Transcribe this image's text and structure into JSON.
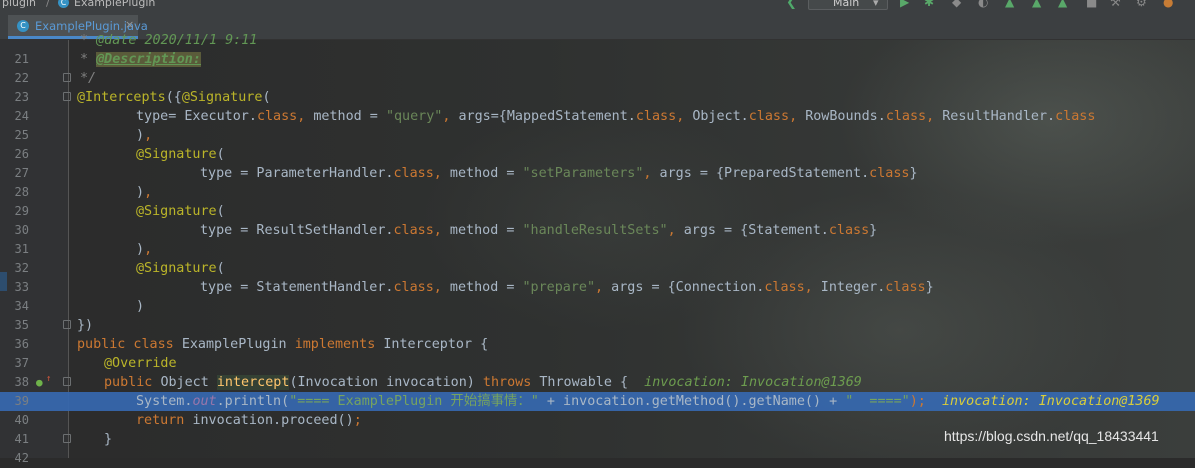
{
  "breadcrumb": {
    "project": "plugin",
    "file": "ExamplePlugin"
  },
  "toolbar": {
    "run_config": "Main",
    "run_config_caret": "▾"
  },
  "tab": {
    "label": "ExamplePlugin.java",
    "icon_letter": "C",
    "close": "×"
  },
  "gutter": {
    "icons": [
      "implements-method-icon",
      "fold-icon"
    ]
  },
  "editor": {
    "lines": [
      {
        "n": "",
        "indent": 1,
        "tokens": [
          {
            "t": "* ",
            "c": "cmt"
          },
          {
            "t": "@date 2020/11/1 9:11",
            "c": "doc"
          }
        ]
      },
      {
        "n": "21",
        "indent": 1,
        "tokens": [
          {
            "t": "* ",
            "c": "cmt"
          },
          {
            "t": "@Description:",
            "c": "doctag"
          }
        ]
      },
      {
        "n": "22",
        "indent": 1,
        "fold": true,
        "tokens": [
          {
            "t": "*/",
            "c": "cmt"
          }
        ]
      },
      {
        "n": "23",
        "indent": 0,
        "fold": true,
        "tokens": [
          {
            "t": "@Intercepts",
            "c": "ann"
          },
          {
            "t": "({",
            "c": "def"
          },
          {
            "t": "@Signature",
            "c": "ann"
          },
          {
            "t": "(",
            "c": "def"
          }
        ]
      },
      {
        "n": "24",
        "indent": 8,
        "tokens": [
          {
            "t": "type",
            "c": "def"
          },
          {
            "t": "= Executor.",
            "c": "def"
          },
          {
            "t": "class",
            "c": "kw"
          },
          {
            "t": ", ",
            "c": "kw"
          },
          {
            "t": "method = ",
            "c": "def"
          },
          {
            "t": "\"query\"",
            "c": "str"
          },
          {
            "t": ", ",
            "c": "kw"
          },
          {
            "t": "args={MappedStatement.",
            "c": "def"
          },
          {
            "t": "class",
            "c": "kw"
          },
          {
            "t": ", ",
            "c": "kw"
          },
          {
            "t": "Object.",
            "c": "def"
          },
          {
            "t": "class",
            "c": "kw"
          },
          {
            "t": ", ",
            "c": "kw"
          },
          {
            "t": "RowBounds.",
            "c": "def"
          },
          {
            "t": "class",
            "c": "kw"
          },
          {
            "t": ", ",
            "c": "kw"
          },
          {
            "t": "ResultHandler.",
            "c": "def"
          },
          {
            "t": "class",
            "c": "kw"
          }
        ]
      },
      {
        "n": "25",
        "indent": 8,
        "tokens": [
          {
            "t": ")",
            "c": "def"
          },
          {
            "t": ",",
            "c": "kw"
          }
        ]
      },
      {
        "n": "26",
        "indent": 8,
        "tokens": [
          {
            "t": "@Signature",
            "c": "ann"
          },
          {
            "t": "(",
            "c": "def"
          }
        ]
      },
      {
        "n": "27",
        "indent": 16,
        "tokens": [
          {
            "t": "type = ParameterHandler.",
            "c": "def"
          },
          {
            "t": "class",
            "c": "kw"
          },
          {
            "t": ", ",
            "c": "kw"
          },
          {
            "t": "method = ",
            "c": "def"
          },
          {
            "t": "\"setParameters\"",
            "c": "str"
          },
          {
            "t": ", ",
            "c": "kw"
          },
          {
            "t": "args = {PreparedStatement.",
            "c": "def"
          },
          {
            "t": "class",
            "c": "kw"
          },
          {
            "t": "}",
            "c": "def"
          }
        ]
      },
      {
        "n": "28",
        "indent": 8,
        "tokens": [
          {
            "t": ")",
            "c": "def"
          },
          {
            "t": ",",
            "c": "kw"
          }
        ]
      },
      {
        "n": "29",
        "indent": 8,
        "tokens": [
          {
            "t": "@Signature",
            "c": "ann"
          },
          {
            "t": "(",
            "c": "def"
          }
        ]
      },
      {
        "n": "30",
        "indent": 16,
        "tokens": [
          {
            "t": "type = ResultSetHandler.",
            "c": "def"
          },
          {
            "t": "class",
            "c": "kw"
          },
          {
            "t": ", ",
            "c": "kw"
          },
          {
            "t": "method = ",
            "c": "def"
          },
          {
            "t": "\"handleResultSets\"",
            "c": "str"
          },
          {
            "t": ", ",
            "c": "kw"
          },
          {
            "t": "args = {Statement.",
            "c": "def"
          },
          {
            "t": "class",
            "c": "kw"
          },
          {
            "t": "}",
            "c": "def"
          }
        ]
      },
      {
        "n": "31",
        "indent": 8,
        "tokens": [
          {
            "t": ")",
            "c": "def"
          },
          {
            "t": ",",
            "c": "kw"
          }
        ]
      },
      {
        "n": "32",
        "indent": 8,
        "tokens": [
          {
            "t": "@Signature",
            "c": "ann"
          },
          {
            "t": "(",
            "c": "def"
          }
        ]
      },
      {
        "n": "33",
        "indent": 16,
        "tokens": [
          {
            "t": "type = StatementHandler.",
            "c": "def"
          },
          {
            "t": "class",
            "c": "kw"
          },
          {
            "t": ", ",
            "c": "kw"
          },
          {
            "t": "method = ",
            "c": "def"
          },
          {
            "t": "\"prepare\"",
            "c": "str"
          },
          {
            "t": ", ",
            "c": "kw"
          },
          {
            "t": "args = {Connection.",
            "c": "def"
          },
          {
            "t": "class",
            "c": "kw"
          },
          {
            "t": ", ",
            "c": "kw"
          },
          {
            "t": "Integer.",
            "c": "def"
          },
          {
            "t": "class",
            "c": "kw"
          },
          {
            "t": "}",
            "c": "def"
          }
        ]
      },
      {
        "n": "34",
        "indent": 8,
        "tokens": [
          {
            "t": ")",
            "c": "def"
          }
        ]
      },
      {
        "n": "35",
        "indent": 0,
        "fold": true,
        "tokens": [
          {
            "t": "})",
            "c": "def"
          }
        ]
      },
      {
        "n": "36",
        "indent": 0,
        "tokens": [
          {
            "t": "public class ",
            "c": "kw"
          },
          {
            "t": "ExamplePlugin ",
            "c": "def"
          },
          {
            "t": "implements ",
            "c": "kw"
          },
          {
            "t": "Interceptor {",
            "c": "def"
          }
        ]
      },
      {
        "n": "37",
        "indent": 4,
        "tokens": [
          {
            "t": "@Override",
            "c": "ann"
          }
        ]
      },
      {
        "n": "38",
        "indent": 4,
        "fold": true,
        "gicon": true,
        "tokens": [
          {
            "t": "public ",
            "c": "kw"
          },
          {
            "t": "Object ",
            "c": "def"
          },
          {
            "t": "intercept",
            "c": "meth"
          },
          {
            "t": "(Invocation invocation) ",
            "c": "def"
          },
          {
            "t": "throws ",
            "c": "kw"
          },
          {
            "t": "Throwable {  ",
            "c": "def"
          },
          {
            "t": "invocation: Invocation@1369",
            "c": "hint"
          }
        ]
      },
      {
        "n": "39",
        "indent": 8,
        "hl": true,
        "tokens": [
          {
            "t": "System.",
            "c": "def"
          },
          {
            "t": "out",
            "c": "field"
          },
          {
            "t": ".println(",
            "c": "def"
          },
          {
            "t": "\"==== ExamplePlugin 开始搞事情：\"",
            "c": "str"
          },
          {
            "t": " + invocation.getMethod().getName() + ",
            "c": "def"
          },
          {
            "t": "\"  ====\"",
            "c": "str"
          },
          {
            "t": ");",
            "c": "kw"
          },
          {
            "t": "  invocation: Invocation@1369",
            "c": "hint"
          }
        ]
      },
      {
        "n": "40",
        "indent": 8,
        "tokens": [
          {
            "t": "return ",
            "c": "kw"
          },
          {
            "t": "invocation.proceed()",
            "c": "def"
          },
          {
            "t": ";",
            "c": "kw"
          }
        ]
      },
      {
        "n": "41",
        "indent": 4,
        "fold": true,
        "tokens": [
          {
            "t": "}",
            "c": "def"
          }
        ]
      },
      {
        "n": "42",
        "indent": 0,
        "tokens": []
      }
    ]
  },
  "watermark": "https://blog.csdn.net/qq_18433441"
}
